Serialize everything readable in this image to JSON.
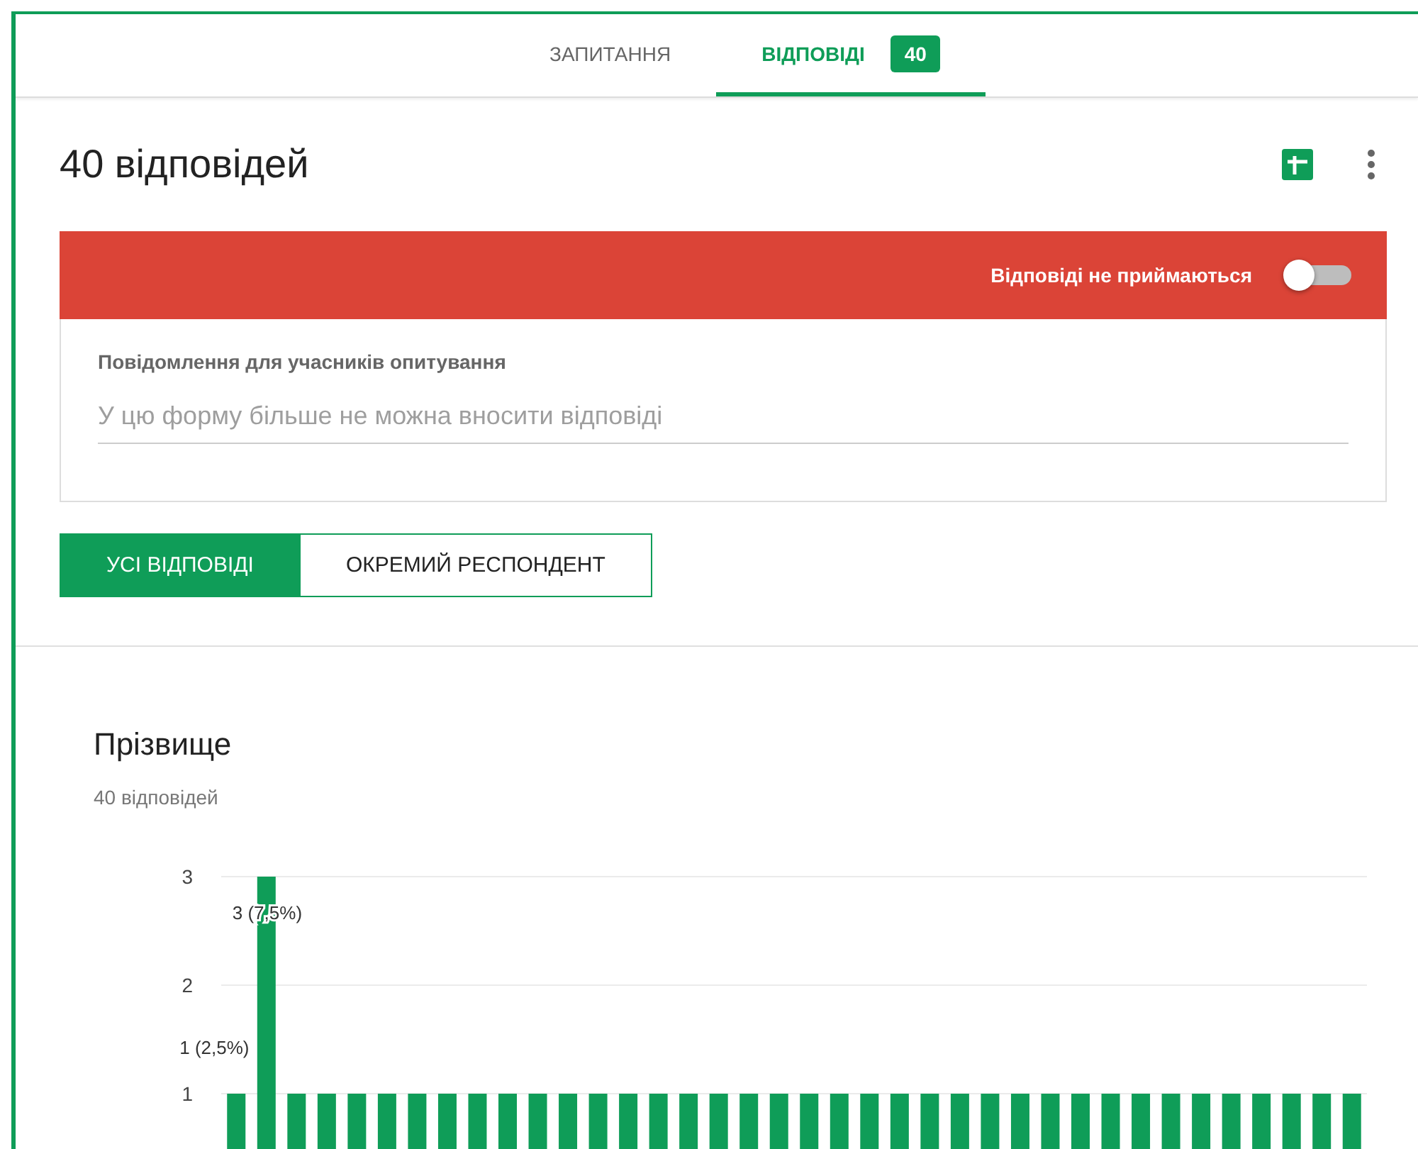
{
  "tabs": [
    {
      "label": "ЗАПИТАННЯ",
      "selected": false
    },
    {
      "label": "ВІДПОВІДІ",
      "selected": true,
      "badge": "40"
    }
  ],
  "summary": {
    "title": "40 відповідей",
    "accepting_responses": false,
    "status_label": "Відповіді не приймаються",
    "message_label": "Повідомлення для учасників опитування",
    "message_placeholder": "У цю форму більше не можна вносити відповіді"
  },
  "view_toggle": [
    {
      "label": "УСІ ВІДПОВІДІ",
      "selected": true
    },
    {
      "label": "ОКРЕМИЙ РЕСПОНДЕНТ",
      "selected": false
    }
  ],
  "question": {
    "title": "Прізвище",
    "count": "40 відповідей",
    "chart_data": {
      "type": "bar",
      "values": [
        1,
        3,
        1,
        1,
        1,
        1,
        1,
        1,
        1,
        1,
        1,
        1,
        1,
        1,
        1,
        1,
        1,
        1,
        1,
        1,
        1,
        1,
        1,
        1,
        1,
        1,
        1,
        1,
        1,
        1,
        1,
        1,
        1,
        1,
        1,
        1,
        1,
        1
      ],
      "ylim": [
        0,
        3
      ],
      "yticks": [
        1,
        2,
        3
      ],
      "annotations": [
        "1 (2,5%)",
        "3 (7,5%)"
      ]
    }
  }
}
